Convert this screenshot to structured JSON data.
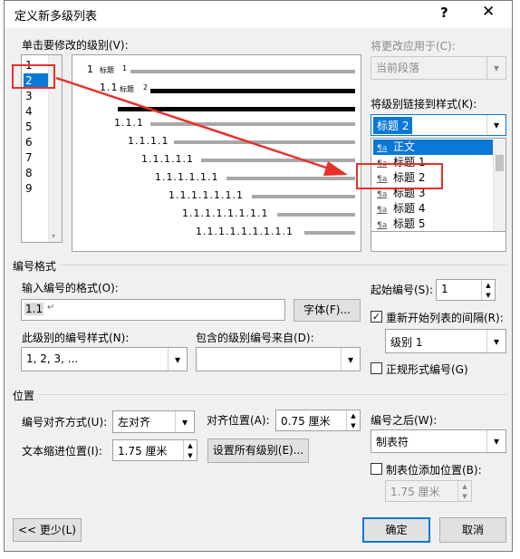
{
  "dialog": {
    "title": "定义新多级列表",
    "help_label": "?",
    "close_label": "✕"
  },
  "levels": {
    "label": "单击要修改的级别(V):",
    "items": [
      "1",
      "2",
      "3",
      "4",
      "5",
      "6",
      "7",
      "8",
      "9"
    ],
    "selected": "2"
  },
  "preview": {
    "level1_num": "1",
    "level1_text": "标题",
    "level1_sub": "1",
    "level2_num": "1.1",
    "level2_text": "标题",
    "level2_sub": "2",
    "rows": [
      "1.1.1",
      "1.1.1.1",
      "1.1.1.1.1",
      "1.1.1.1.1.1",
      "1.1.1.1.1.1.1",
      "1.1.1.1.1.1.1.1",
      "1.1.1.1.1.1.1.1.1"
    ]
  },
  "apply_to": {
    "label": "将更改应用于(C):",
    "value": "当前段落"
  },
  "link_style": {
    "label": "将级别链接到样式(K):",
    "value": "标题 2",
    "options": [
      "正文",
      "标题 1",
      "标题 2",
      "标题 3",
      "标题 4",
      "标题 5"
    ],
    "selected": "正文",
    "icon_text": "¶a"
  },
  "number_format": {
    "section_label": "编号格式",
    "format_label": "输入编号的格式(O):",
    "format_value": "1.1",
    "format_mark": "↵",
    "font_button": "字体(F)...",
    "style_label": "此级别的编号样式(N):",
    "style_value": "1, 2, 3, ...",
    "include_label": "包含的级别编号来自(D):",
    "include_value": ""
  },
  "start_at": {
    "label": "起始编号(S):",
    "value": "1"
  },
  "restart": {
    "label": "重新开始列表的间隔(R):",
    "checked": true,
    "value": "级别 1"
  },
  "legal": {
    "label": "正规形式编号(G)",
    "checked": false
  },
  "position": {
    "section_label": "位置",
    "align_label": "编号对齐方式(U):",
    "align_value": "左对齐",
    "align_at_label": "对齐位置(A):",
    "align_at_value": "0.75 厘米",
    "indent_label": "文本缩进位置(I):",
    "indent_value": "1.75 厘米",
    "set_all_button": "设置所有级别(E)..."
  },
  "follow": {
    "label": "编号之后(W):",
    "value": "制表符",
    "tab_add_label": "制表位添加位置(B):",
    "tab_add_checked": false,
    "tab_add_value": "1.75 厘米"
  },
  "buttons": {
    "less": "<< 更少(L)",
    "ok": "确定",
    "cancel": "取消"
  },
  "icons": {
    "dropdown": "▾",
    "check": "✓",
    "spin_up": "▲",
    "spin_down": "▼"
  },
  "colors": {
    "selection": "#0a78d7",
    "annotation": "#e8302a"
  }
}
